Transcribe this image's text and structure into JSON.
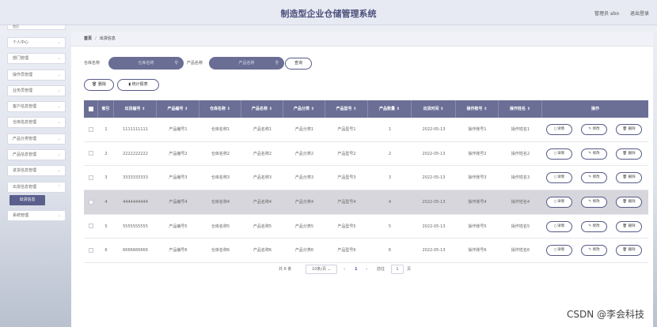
{
  "header": {
    "title": "制造型企业仓储管理系统",
    "user": "管理员 abo",
    "logout": "退出登录"
  },
  "sidebar": {
    "top": "首页",
    "items": [
      {
        "label": "个人中心"
      },
      {
        "label": "部门管理"
      },
      {
        "label": "操作员管理"
      },
      {
        "label": "业务员管理"
      },
      {
        "label": "客户信息管理"
      },
      {
        "label": "仓库信息管理"
      },
      {
        "label": "产品分类管理"
      },
      {
        "label": "产品信息管理"
      },
      {
        "label": "进货信息管理"
      },
      {
        "label": "出货信息管理"
      }
    ],
    "active_sub": "出货信息",
    "last": "系统管理"
  },
  "breadcrumb": {
    "home": "首页",
    "current": "出货信息"
  },
  "search": {
    "warehouse_label": "仓库名称",
    "warehouse_placeholder": "仓库名称",
    "product_label": "产品名称",
    "product_placeholder": "产品名称",
    "query": "查询"
  },
  "actions": {
    "delete": "删除",
    "stats": "统计报表"
  },
  "table": {
    "headers": [
      "索引",
      "出货编号 ⇕",
      "产品编号 ⇕",
      "仓库名称 ⇕",
      "产品名称 ⇕",
      "产品分类 ⇕",
      "产品型号 ⇕",
      "产品数量 ⇕",
      "出货时间 ⇕",
      "操作账号 ⇕",
      "操作姓名 ⇕",
      "操作"
    ],
    "op_labels": {
      "detail": "详情",
      "edit": "修改",
      "delete": "删除"
    },
    "rows": [
      [
        "1",
        "1111111111",
        "产品编号1",
        "仓库名称1",
        "产品名称1",
        "产品分类1",
        "产品型号1",
        "1",
        "2022-05-13",
        "操作账号1",
        "操作姓名1"
      ],
      [
        "2",
        "2222222222",
        "产品编号2",
        "仓库名称2",
        "产品名称2",
        "产品分类2",
        "产品型号2",
        "2",
        "2022-05-13",
        "操作账号2",
        "操作姓名2"
      ],
      [
        "3",
        "3333333333",
        "产品编号3",
        "仓库名称3",
        "产品名称3",
        "产品分类3",
        "产品型号3",
        "3",
        "2022-05-13",
        "操作账号3",
        "操作姓名3"
      ],
      [
        "4",
        "4444444444",
        "产品编号4",
        "仓库名称4",
        "产品名称4",
        "产品分类4",
        "产品型号4",
        "4",
        "2022-05-13",
        "操作账号4",
        "操作姓名4"
      ],
      [
        "5",
        "5555555555",
        "产品编号5",
        "仓库名称5",
        "产品名称5",
        "产品分类5",
        "产品型号5",
        "5",
        "2022-05-13",
        "操作账号5",
        "操作姓名5"
      ],
      [
        "6",
        "6666666666",
        "产品编号6",
        "仓库名称6",
        "产品名称6",
        "产品分类6",
        "产品型号6",
        "6",
        "2022-05-13",
        "操作账号6",
        "操作姓名6"
      ]
    ],
    "highlight_row": 3
  },
  "pagination": {
    "total": "共 6 条",
    "page_size": "10条/页",
    "prev": "‹",
    "page": "1",
    "next": "›",
    "goto": "前往",
    "goto_value": "1",
    "page_unit": "页"
  },
  "watermark": "CSDN @李会科技",
  "colors": {
    "accent": "#6b6f96",
    "accent_dark": "#565a86",
    "active_sub": "#5b5f8c"
  }
}
